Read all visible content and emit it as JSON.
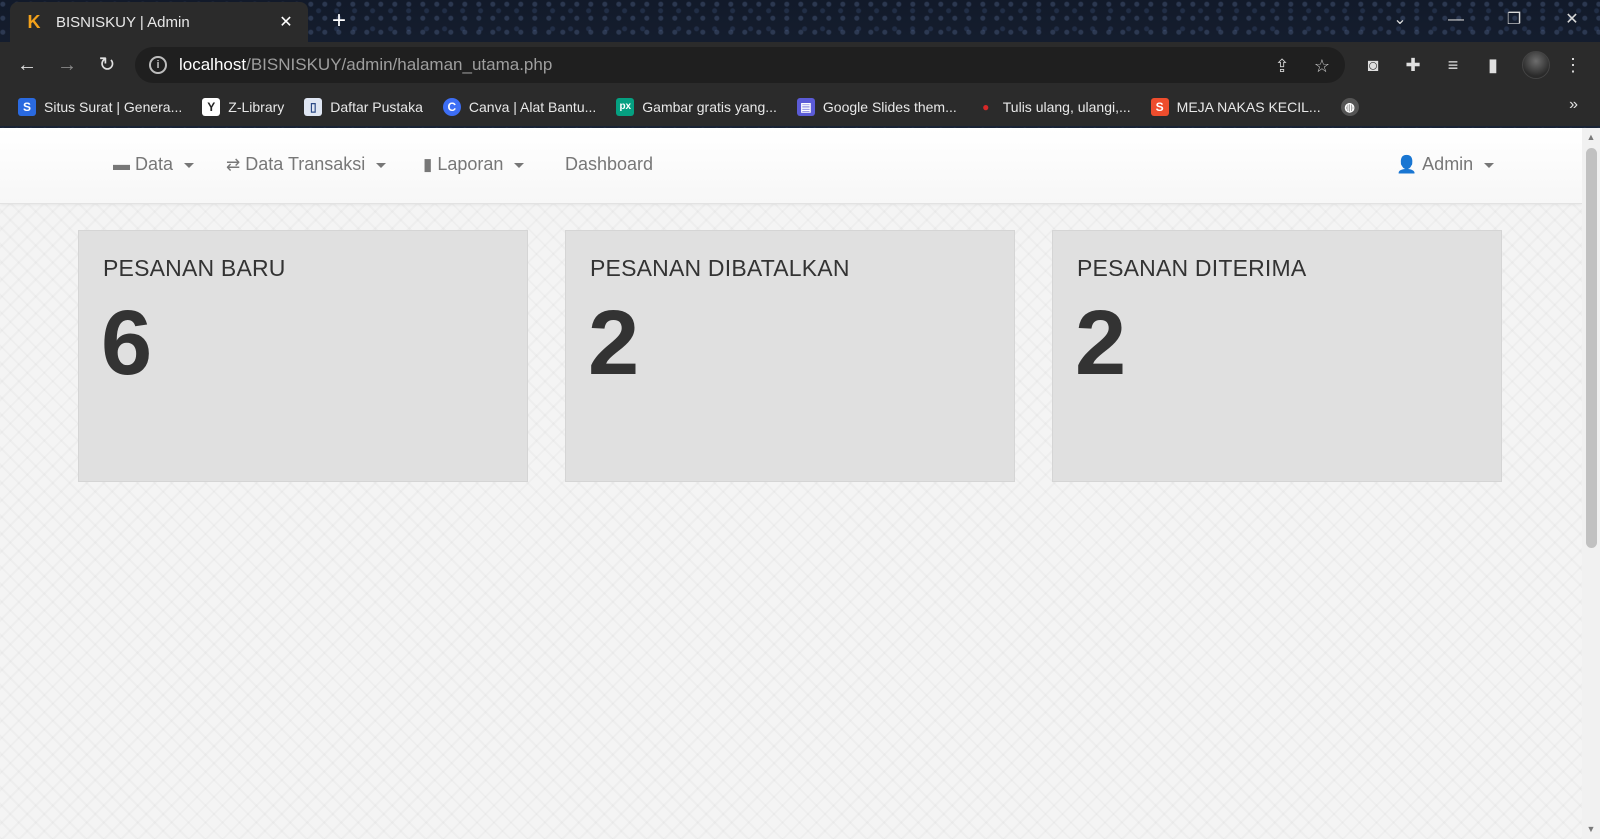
{
  "browser": {
    "tab": {
      "title": "BISNISKUY | Admin",
      "favicon": "K"
    },
    "url": {
      "host": "localhost",
      "path": "/BISNISKUY/admin/halaman_utama.php"
    },
    "bookmarks": [
      {
        "label": "Situs Surat | Genera...",
        "icon": "S",
        "color": "#2a6ae0"
      },
      {
        "label": "Z-Library",
        "icon": "Y",
        "color": "#ffffff"
      },
      {
        "label": "Daftar Pustaka",
        "icon": "▯",
        "color": "#dfe6f3"
      },
      {
        "label": "Canva | Alat Bantu...",
        "icon": "C",
        "color": "#3d6ef5"
      },
      {
        "label": "Gambar gratis yang...",
        "icon": "px",
        "color": "#05a081"
      },
      {
        "label": "Google Slides them...",
        "icon": "▤",
        "color": "#5b5bd6"
      },
      {
        "label": "Tulis ulang, ulangi,...",
        "icon": "●",
        "color": "#d62828"
      },
      {
        "label": "MEJA NAKAS KECIL...",
        "icon": "S",
        "color": "#ee4d2d"
      }
    ]
  },
  "navbar": {
    "data_label": "Data",
    "transaksi_label": "Data Transaksi",
    "laporan_label": "Laporan",
    "dashboard_label": "Dashboard",
    "admin_label": "Admin"
  },
  "cards": [
    {
      "label": "PESANAN BARU",
      "value": "6"
    },
    {
      "label": "PESANAN DIBATALKAN",
      "value": "2"
    },
    {
      "label": "PESANAN DITERIMA",
      "value": "2"
    }
  ]
}
